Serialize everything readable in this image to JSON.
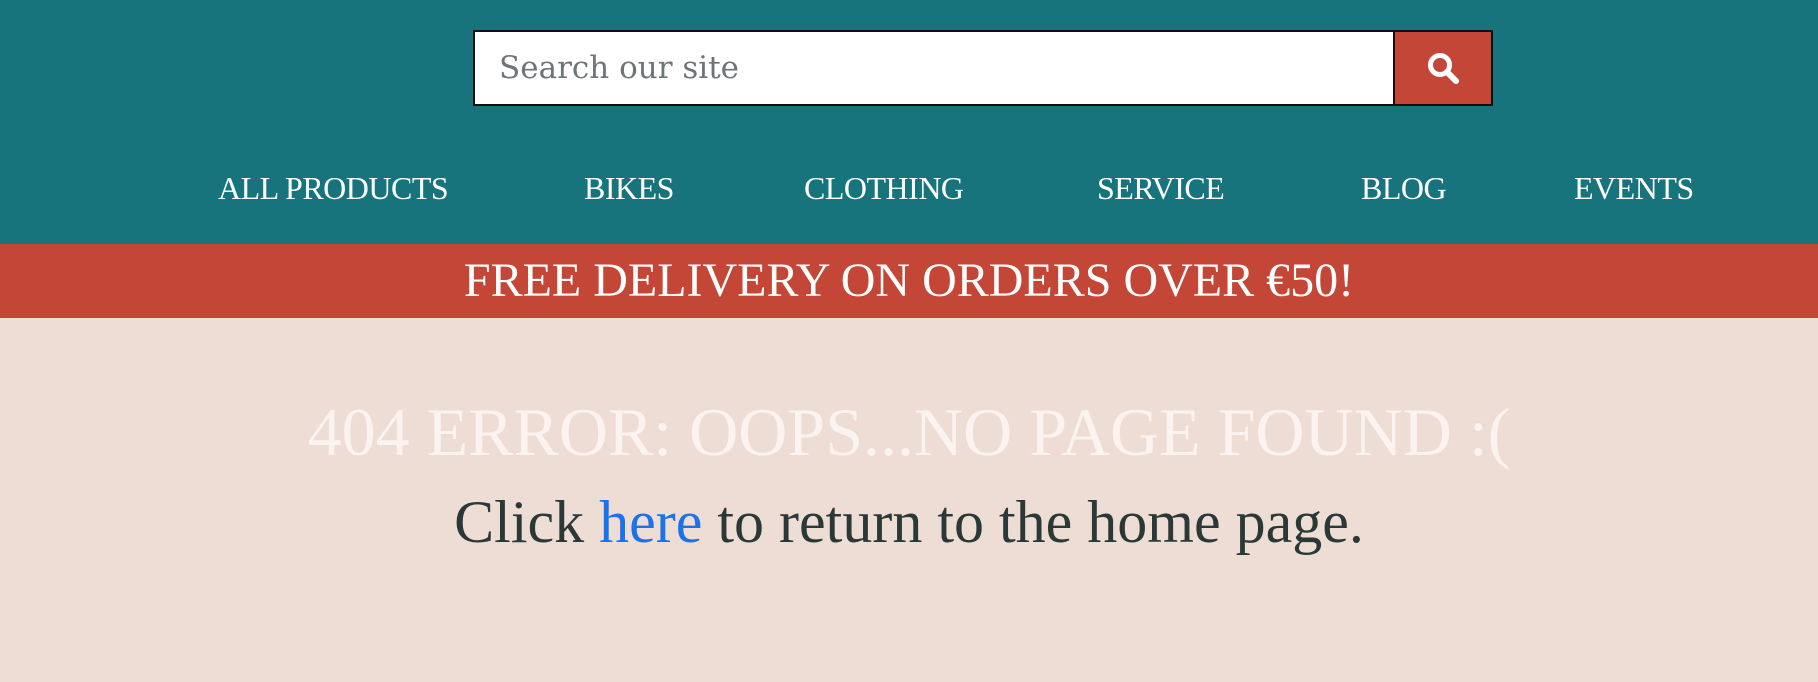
{
  "search": {
    "placeholder": "Search our site",
    "value": ""
  },
  "search_button": {
    "icon": "magnifier-icon"
  },
  "nav": {
    "items": [
      {
        "label": "ALL PRODUCTS"
      },
      {
        "label": "BIKES"
      },
      {
        "label": "CLOTHING"
      },
      {
        "label": "SERVICE"
      },
      {
        "label": "BLOG"
      },
      {
        "label": "EVENTS"
      }
    ]
  },
  "promo": {
    "text": "FREE DELIVERY ON ORDERS OVER €50!"
  },
  "error": {
    "title": "404 ERROR: OOPS...NO PAGE FOUND :(",
    "prefix": "Click",
    "link_label": "here",
    "suffix": "to return to the home page."
  },
  "colors": {
    "header_background": "#17747c",
    "accent_red": "#c44636",
    "page_background": "#eeddd5",
    "link_blue": "#1a73e8",
    "body_text": "#2a3937"
  }
}
